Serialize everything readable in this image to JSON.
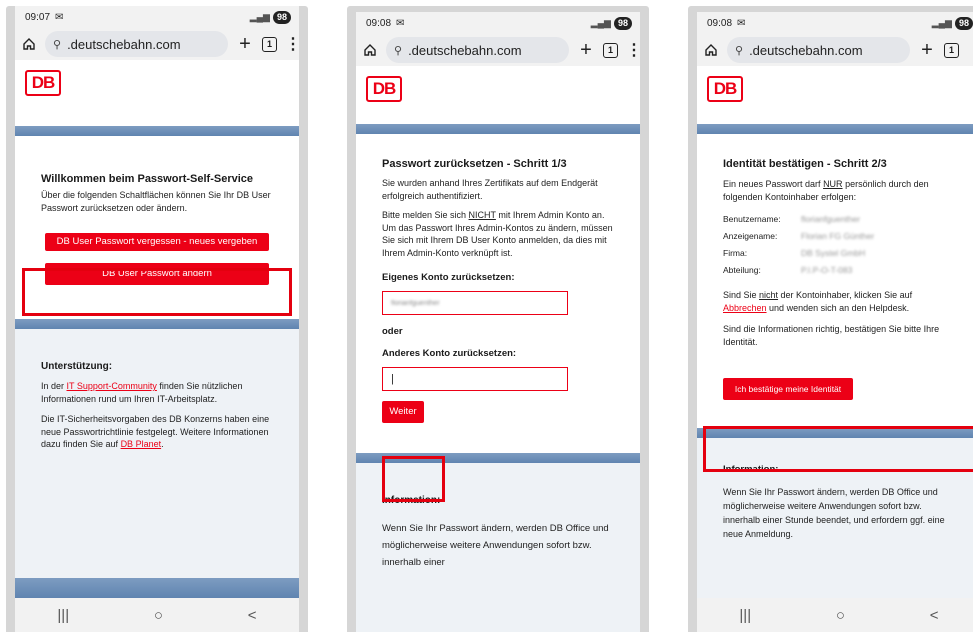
{
  "phones": [
    {
      "status": {
        "time": "09:07",
        "battery": "98"
      },
      "browser": {
        "url": ".deutschebahn.com",
        "tab_count": "1"
      },
      "logo": "DB",
      "welcome": {
        "title": "Willkommen beim Passwort-Self-Service",
        "text": "Über die folgenden Schaltflächen können Sie Ihr DB User Passwort zurücksetzen oder ändern."
      },
      "buttons": {
        "forgot": "DB User Passwort vergessen - neues vergeben",
        "change": "DB User Passwort ändern"
      },
      "support": {
        "title": "Unterstützung:",
        "p1_pre": "In der ",
        "p1_link": "IT Support-Community",
        "p1_post": " finden Sie nützlichen Informationen rund um Ihren IT-Arbeitsplatz.",
        "p2_pre": "Die IT-Sicherheitsvorgaben des DB Konzerns haben eine neue Passwortrichtlinie festgelegt. Weitere Informationen dazu finden Sie auf ",
        "p2_link": "DB Planet",
        "p2_post": "."
      }
    },
    {
      "status": {
        "time": "09:08",
        "battery": "98"
      },
      "browser": {
        "url": ".deutschebahn.com",
        "tab_count": "1"
      },
      "logo": "DB",
      "title": "Passwort zurücksetzen - Schritt 1/3",
      "intro": "Sie wurden anhand Ihres Zertifikats auf dem Endgerät erfolgreich authentifiziert.",
      "warn_pre": "Bitte melden Sie sich ",
      "warn_em": "NICHT",
      "warn_post": " mit Ihrem Admin Konto an. Um das Passwort Ihres Admin-Kontos zu ändern, müssen Sie sich mit Ihrem DB User Konto anmelden, da dies mit Ihrem Admin-Konto verknüpft ist.",
      "own_label": "Eigenes Konto zurücksetzen:",
      "own_value": "florianfguenther",
      "or_label": "oder",
      "other_label": "Anderes Konto zurücksetzen:",
      "next_button": "Weiter",
      "info_title": "Information:",
      "info_text": "Wenn Sie Ihr Passwort ändern, werden DB Office und möglicherweise weitere Anwendungen sofort bzw. innerhalb einer"
    },
    {
      "status": {
        "time": "09:08",
        "battery": "98"
      },
      "browser": {
        "url": ".deutschebahn.com",
        "tab_count": "1"
      },
      "logo": "DB",
      "title": "Identität bestätigen - Schritt 2/3",
      "intro_pre": "Ein neues Passwort darf ",
      "intro_em": "NUR",
      "intro_post": " persönlich durch den folgenden Kontoinhaber erfolgen:",
      "rows": [
        {
          "k": "Benutzername:",
          "v": "florianfguenther"
        },
        {
          "k": "Anzeigename:",
          "v": "Florian FG Günther"
        },
        {
          "k": "Firma:",
          "v": "DB Systel GmbH"
        },
        {
          "k": "Abteilung:",
          "v": "P.I.P-O-T-083"
        }
      ],
      "notice_pre": "Sind Sie ",
      "notice_em": "nicht",
      "notice_mid": " der Kontoinhaber, klicken Sie auf ",
      "notice_link": "Abbrechen",
      "notice_post": " und wenden sich an den Helpdesk.",
      "confirm_text": "Sind die Informationen richtig, bestätigen Sie bitte Ihre Identität.",
      "confirm_button": "Ich bestätige meine Identität",
      "info_title": "Information:",
      "info_text": "Wenn Sie Ihr Passwort ändern, werden DB Office und möglicherweise weitere Anwendungen sofort bzw. innerhalb einer Stunde beendet, und erfordern ggf. eine neue Anmeldung."
    }
  ],
  "nav": {
    "recent": "|||",
    "home": "○",
    "back": "<"
  },
  "colors": {
    "db_red": "#ec0016",
    "highlight": "#e4000f",
    "blue_bar": "#6b8db6"
  }
}
